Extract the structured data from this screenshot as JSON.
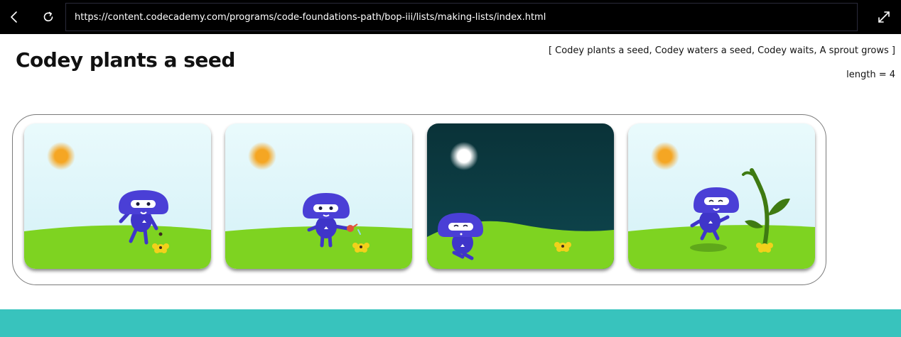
{
  "browser": {
    "url": "https://content.codecademy.com/programs/code-foundations-path/bop-iii/lists/making-lists/index.html",
    "icons": [
      "chevron-left-icon",
      "refresh-icon",
      "expand-icon"
    ]
  },
  "main": {
    "title": "Codey plants a seed",
    "list_display": "[ Codey plants a seed, Codey waters a seed, Codey waits, A sprout grows ]",
    "length_display": "length = 4"
  },
  "cards": [
    {
      "scene": "day",
      "action": "plants a seed"
    },
    {
      "scene": "day",
      "action": "waters a seed"
    },
    {
      "scene": "night",
      "action": "waits"
    },
    {
      "scene": "day",
      "action": "sprout grows"
    }
  ],
  "colors": {
    "sky_day": "#dff6fa",
    "sky_night": "#0b3b42",
    "grass": "#7ed321",
    "codey": "#3f35c9",
    "sun": "#f5a623",
    "flower": "#f2d11b",
    "sprout": "#3f7a12",
    "accent_band": "#38c3bd"
  }
}
